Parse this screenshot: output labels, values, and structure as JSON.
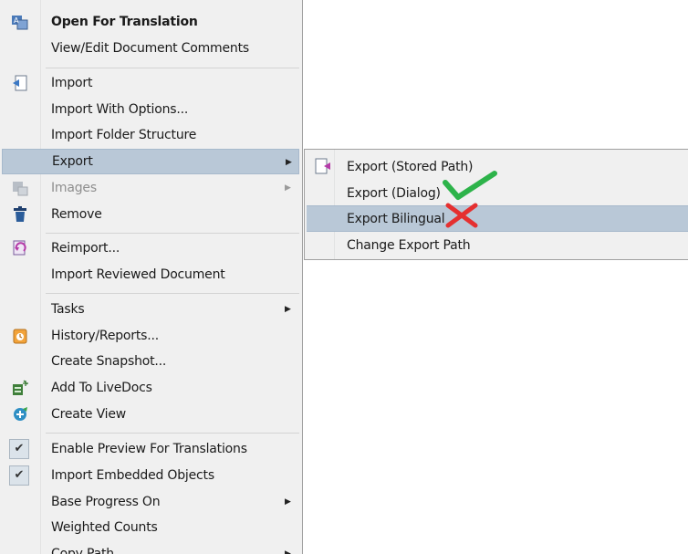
{
  "menu": {
    "items": [
      {
        "label": "Open For Translation",
        "icon": "translate-icon"
      },
      {
        "label": "View/Edit Document Comments"
      },
      {
        "label": "Import",
        "icon": "import-icon"
      },
      {
        "label": "Import With Options..."
      },
      {
        "label": "Import Folder Structure"
      },
      {
        "label": "Export",
        "has_submenu": true,
        "highlighted": true
      },
      {
        "label": "Images",
        "icon": "images-icon",
        "has_submenu": true,
        "disabled": true
      },
      {
        "label": "Remove",
        "icon": "remove-icon"
      },
      {
        "label": "Reimport...",
        "icon": "reimport-icon"
      },
      {
        "label": "Import Reviewed Document"
      },
      {
        "label": "Tasks",
        "has_submenu": true
      },
      {
        "label": "History/Reports...",
        "icon": "history-icon"
      },
      {
        "label": "Create Snapshot..."
      },
      {
        "label": "Add To LiveDocs",
        "icon": "livedocs-icon"
      },
      {
        "label": "Create View",
        "icon": "create-view-icon"
      },
      {
        "label": "Enable Preview For Translations",
        "checked": true
      },
      {
        "label": "Import Embedded Objects",
        "checked": true
      },
      {
        "label": "Base Progress On",
        "has_submenu": true
      },
      {
        "label": "Weighted Counts"
      },
      {
        "label": "Copy Path",
        "has_submenu": true
      }
    ],
    "submenu_glyph": "▶",
    "check_glyph": "✔"
  },
  "submenu": {
    "items": [
      {
        "label": "Export (Stored Path)",
        "icon": "export-icon"
      },
      {
        "label": "Export (Dialog)",
        "annotation": "green-checkmark"
      },
      {
        "label": "Export Bilingual",
        "highlighted": true,
        "annotation": "red-cross"
      },
      {
        "label": "Change Export Path"
      }
    ]
  },
  "colors": {
    "menu_bg": "#f0f0f0",
    "highlight": "#b9c8d7",
    "green_mark": "#2db34a",
    "red_mark": "#e53030"
  }
}
